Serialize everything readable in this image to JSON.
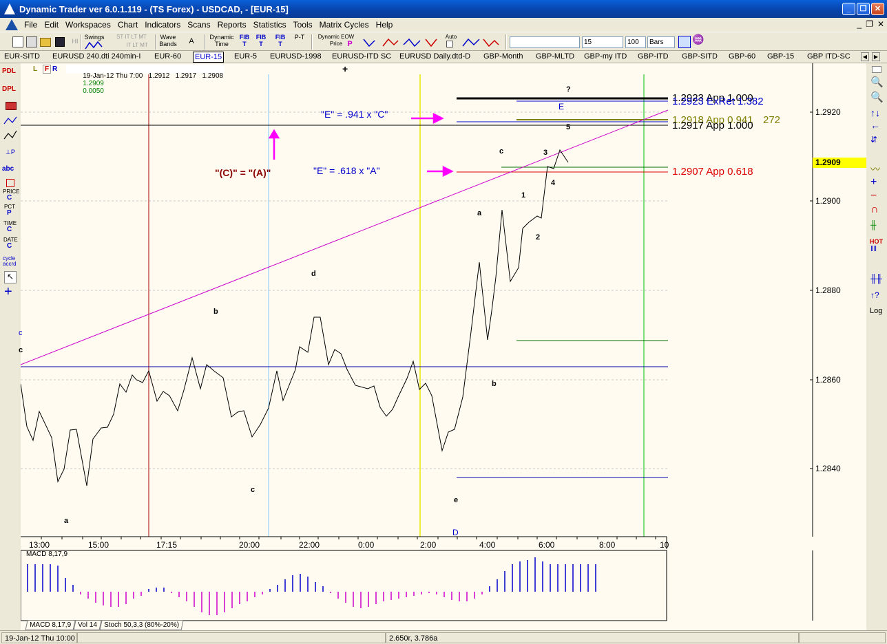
{
  "window": {
    "title": "Dynamic Trader ver 6.0.1.119 - (TS Forex) - USDCAD, - [EUR-15]",
    "minimize": "_",
    "restore": "❐",
    "close": "✕"
  },
  "menu": {
    "items": [
      "File",
      "Edit",
      "Workspaces",
      "Chart",
      "Indicators",
      "Scans",
      "Reports",
      "Statistics",
      "Tools",
      "Matrix Cycles",
      "Help"
    ],
    "mdi_min": "_",
    "mdi_restore": "❐",
    "mdi_close": "✕"
  },
  "toolbar": {
    "swings_label": "Swings",
    "swings_sub": "ST IT LT MT",
    "swings_sub2": "IT LT MT",
    "hi_label": "HI",
    "wave_bands_label": "Wave\nBands",
    "a_label": "A",
    "dynamic_time_label": "Dynamic\nTime",
    "fib_t1": "FIB\nT",
    "fib_t2": "FIB\nT",
    "fib_t3": "FIB\nT",
    "pt_label": "P-T",
    "deow_label": "Dynamic EOW\nPrice",
    "p_label": "P",
    "auto_label": "Auto",
    "interval_value": "15",
    "bars_count": "100",
    "bars_unit": "Bars"
  },
  "tabs": [
    "EUR-SITD",
    "EURUSD  240.dti 240min-I",
    "EUR-60",
    "EUR-15",
    "EUR-5",
    "EURUSD-1998",
    "EURUSD-ITD SC",
    "EURUSD  Daily.dtd-D",
    "GBP-Month",
    "GBP-MLTD",
    "GBP-my ITD",
    "GBP-ITD",
    "GBP-SITD",
    "GBP-60",
    "GBP-15",
    "GBP ITD-SC"
  ],
  "active_tab": "EUR-15",
  "left_tools": {
    "pdl": "PDL",
    "dpl": "DPL",
    "abc": "abc",
    "price": "PRICE",
    "price_c": "C",
    "pct": "PCT",
    "pct_p": "P",
    "time": "TIME",
    "time_c": "C",
    "date": "DATE",
    "date_c": "C",
    "cycle": "cycle\naccrd"
  },
  "right_tools": {
    "hot": "HOT",
    "log": "Log",
    "question": "↑?"
  },
  "quote": {
    "l": "L",
    "f": "F",
    "r": "R",
    "line": "19-Jan-12 Thu 7:00   1.2912   1.2917   1.2908",
    "close": "1.2909",
    "change": "0.0050"
  },
  "price_axis": {
    "labels": [
      "1.2920",
      "1.2900",
      "1.2880",
      "1.2860",
      "1.2840"
    ],
    "current": "1.2909"
  },
  "time_axis": {
    "labels": [
      "13:00",
      "15:00",
      "17:15",
      "20:00",
      "22:00",
      "0:00",
      "2:00",
      "4:00",
      "6:00",
      "8:00",
      "10"
    ]
  },
  "projections": {
    "p1": "1.2923 App 1.000",
    "p2": "1.2923 ExRet 1.382",
    "p3": "1.2918 App 0.941",
    "p3b": "272",
    "p4": "1.2917 App 1.000",
    "p5": "1.2907 App 0.618"
  },
  "annotations": {
    "e941": "\"E\" = .941 x \"C\"",
    "e618": "\"E\" = .618 x \"A\"",
    "c_eq_a": "\"(C)\" = \"(A)\""
  },
  "wave_labels": {
    "q": "?",
    "E": "E",
    "five": "5",
    "c_top": "c",
    "three": "3",
    "four": "4",
    "one": "1",
    "a_mid": "a",
    "two": "2",
    "d": "d",
    "b_left": "b",
    "b_right": "b",
    "c_low": "c",
    "a_low": "a",
    "e": "e",
    "D": "D",
    "c_edge1": "c",
    "c_edge2": "c"
  },
  "macd": {
    "label": "MACD 8,17,9"
  },
  "subtabs": [
    "MACD 8,17,9",
    "Vol 14",
    "Stoch 50,3,3 (80%-20%)"
  ],
  "status": {
    "left": "19-Jan-12 Thu 10:00",
    "mid": "2.650r, 3.786a"
  },
  "colors": {
    "price_line": "#000000",
    "trendline": "#cc00cc",
    "arrow": "#ff00ff",
    "blue_text": "#0000cc",
    "red_text": "#8b0000",
    "projection_red": "#dd0000",
    "highlight": "#ffff00"
  }
}
